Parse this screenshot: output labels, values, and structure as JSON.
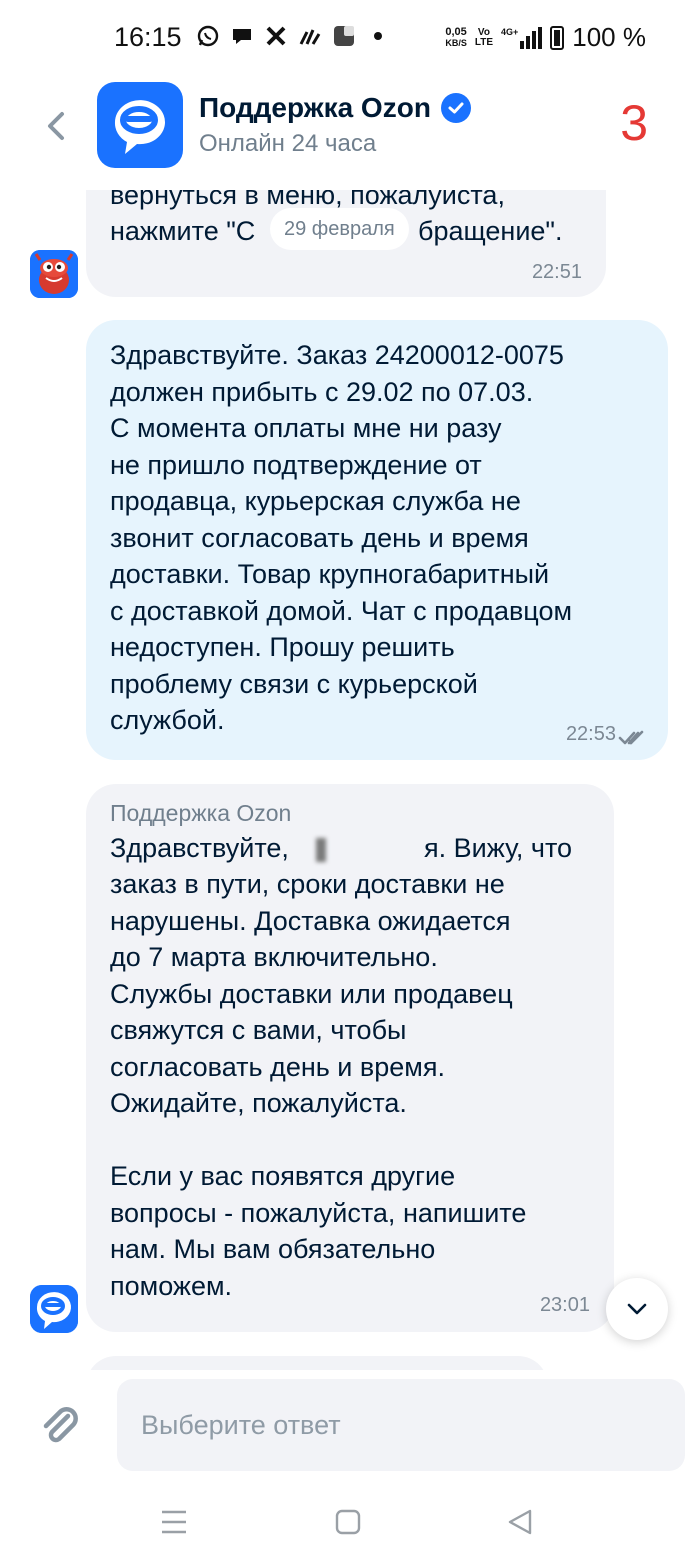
{
  "status_bar": {
    "time": "16:15",
    "net_speed_value": "0,05",
    "net_speed_unit": "KB/S",
    "volte_top": "Vo",
    "volte_bottom": "LTE",
    "network": "4G+",
    "battery": "100 %",
    "icons": [
      "whatsapp-icon",
      "chat-icon",
      "x-icon",
      "music-icon",
      "app-icon",
      "dot-icon"
    ]
  },
  "header": {
    "title": "Поддержка Ozon",
    "subtitle": "Онлайн 24 часа",
    "badge": "3",
    "verified_icon": "verified-check-icon",
    "back_icon": "back-chevron-icon",
    "brand_color": "#1a72ff"
  },
  "chat": {
    "date_pill": "29 февраля",
    "messages": [
      {
        "direction": "incoming",
        "text_top": "вернуться в меню, пожалуйста,",
        "text_left": "нажмите \"С",
        "text_right": "бращение\".",
        "time": "22:51",
        "avatar": "mascot-avatar"
      },
      {
        "direction": "outgoing",
        "text": "Здравствуйте. Заказ 24200012-0075\nдолжен прибыть с 29.02 по 07.03.\nС момента оплаты мне ни разу\nне пришло подтверждение от\nпродавца, курьерская служба не\nзвонит согласовать день и время\nдоставки. Товар крупногабаритный\nс доставкой домой. Чат с продавцом\nнедоступен. Прошу решить\nпроблему связи с курьерской\nслужбой.",
        "time": "22:53",
        "status_icon": "double-check-icon"
      },
      {
        "direction": "incoming",
        "sender": "Поддержка Ozon",
        "greeting_start": "Здравствуйте,",
        "greeting_end": "я. Вижу, что",
        "text": "заказ в пути, сроки доставки не\nнарушены. Доставка ожидается\nдо 7 марта включительно.\nСлужбы доставки или продавец\nсвяжутся с вами, чтобы\nсогласовать день и время.\nОжидайте, пожалуйста.\n\nЕсли у вас появятся другие\nвопросы - пожалуйста, напишите\nнам. Мы вам обязательно\nпоможем.",
        "time": "23:01",
        "avatar": "ozon-avatar"
      }
    ]
  },
  "composer": {
    "placeholder": "Выберите ответ",
    "attach_icon": "paperclip-icon"
  },
  "navbar": {
    "icons": [
      "menu-icon",
      "home-square-icon",
      "back-triangle-icon"
    ]
  }
}
